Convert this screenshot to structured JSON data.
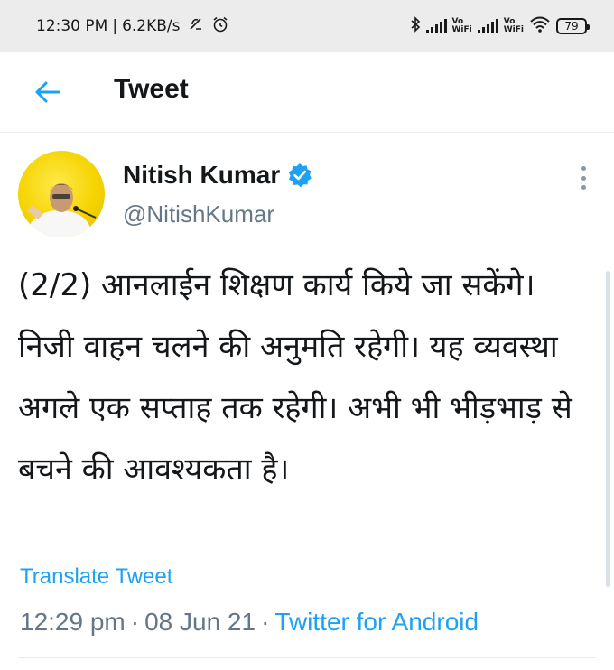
{
  "status_bar": {
    "time": "12:30 PM",
    "separator": "|",
    "data_speed": "6.2KB/s",
    "network_1_label_top": "Vo",
    "network_1_label_bottom": "WiFi",
    "network_2_label_top": "Vo",
    "network_2_label_bottom": "WiFi",
    "battery": "79"
  },
  "header": {
    "title": "Tweet",
    "back_icon": "arrow-left-icon"
  },
  "tweet": {
    "author_name": "Nitish Kumar",
    "handle": "@NitishKumar",
    "verified_icon": "verified-badge-icon",
    "text": "(2/2) आनलाईन शिक्षण कार्य किये जा सकेंगे। निजी वाहन चलने की अनुमति रहेगी। यह व्यवस्था अगले एक सप्ताह तक रहेगी। अभी भी भीड़भाड़ से बचने की आवश्यकता है।",
    "translate_label": "Translate Tweet",
    "time": "12:29 pm",
    "date": "08 Jun 21",
    "meta_separator": "·",
    "source": "Twitter for Android"
  },
  "colors": {
    "accent": "#1da1f2",
    "secondary_text": "#657786",
    "status_bar_bg": "#ececec",
    "avatar_bg": "#f5d400"
  }
}
